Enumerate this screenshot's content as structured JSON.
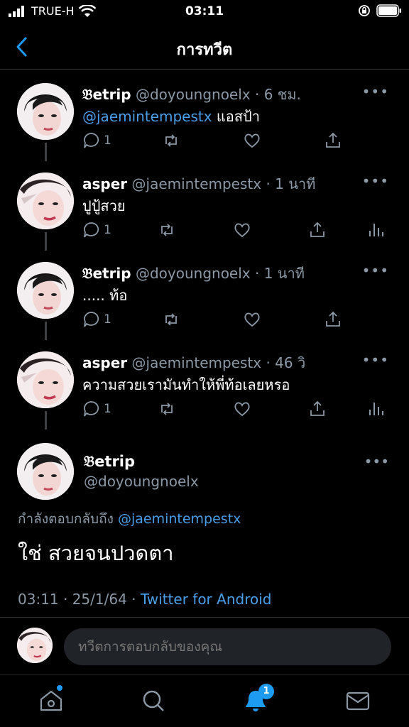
{
  "status_bar": {
    "carrier": "TRUE-H",
    "time": "03:11"
  },
  "nav": {
    "title": "การทวีต"
  },
  "thread": [
    {
      "name": "𝔅etrip",
      "handle": "@doyoungnoelx",
      "time": "· 6 ชม.",
      "mention": "@jaemintempestx",
      "text": " แอสป้า",
      "reply_count": "1",
      "avatar": "doyoung"
    },
    {
      "name": "asper",
      "handle": "@jaemintempestx",
      "time": "· 1 นาที",
      "mention": "",
      "text": "ปูปู้สวย",
      "reply_count": "1",
      "avatar": "jaemin"
    },
    {
      "name": "𝔅etrip",
      "handle": "@doyoungnoelx",
      "time": "· 1 นาที",
      "mention": "",
      "text": "..... ท้อ",
      "reply_count": "1",
      "avatar": "doyoung"
    },
    {
      "name": "asper",
      "handle": "@jaemintempestx",
      "time": "· 46 วิ",
      "mention": "",
      "text": "ความสวยเรามันทำให้พี่ท้อเลยหรอ",
      "reply_count": "1",
      "avatar": "jaemin"
    }
  ],
  "focus": {
    "name": "𝔅etrip",
    "handle": "@doyoungnoelx",
    "replying_label": "กำลังตอบกลับถึง",
    "replying_mention": "@jaemintempestx",
    "text": "ใช่ สวยจนปวดตา",
    "timestamp": "03:11 · 25/1/64 ·",
    "source": "Twitter for Android"
  },
  "reply_bar": {
    "placeholder": "ทวีตการตอบกลับของคุณ"
  },
  "tabbar": {
    "notification_badge": "1"
  },
  "colors": {
    "accent": "#1d9bf0",
    "mention": "#4a9ee8",
    "muted": "#8b98a5",
    "background": "#000000"
  },
  "more_glyph": "•••"
}
